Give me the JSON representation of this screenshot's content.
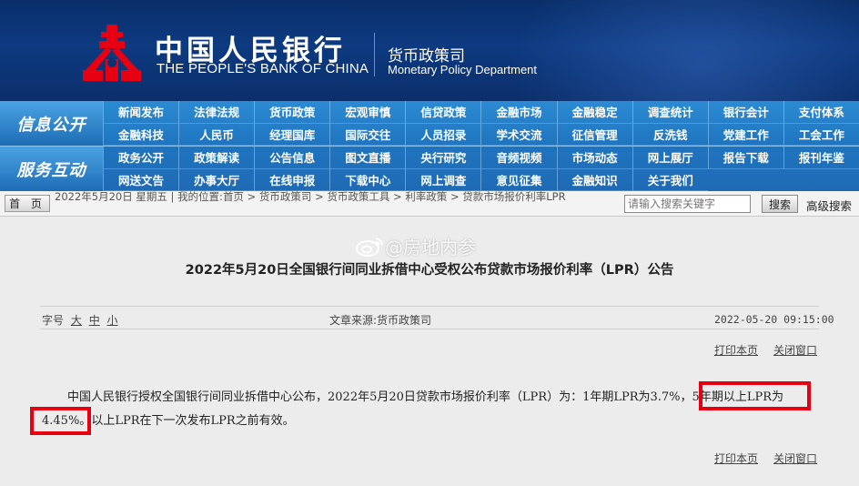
{
  "header": {
    "bank_name_cn": "中国人民银行",
    "bank_name_en": "THE PEOPLE'S BANK OF CHINA",
    "dept_cn": "货币政策司",
    "dept_en": "Monetary Policy Department",
    "bg_color": "#0b3272",
    "logo_color": "#e60012"
  },
  "nav": {
    "section_info": "信息公开",
    "section_service": "服务互动",
    "info_items": [
      "新闻发布",
      "法律法规",
      "货币政策",
      "宏观审慎",
      "信贷政策",
      "金融市场",
      "金融稳定",
      "调查统计",
      "银行会计",
      "支付体系",
      "金融科技",
      "人民币",
      "经理国库",
      "国际交往",
      "人员招录",
      "学术交流",
      "征信管理",
      "反洗钱",
      "党建工作",
      "工会工作"
    ],
    "service_items": [
      "政务公开",
      "政策解读",
      "公告信息",
      "图文直播",
      "央行研究",
      "音频视频",
      "市场动态",
      "网上展厅",
      "报告下载",
      "报刊年鉴",
      "网送文告",
      "办事大厅",
      "在线申报",
      "下载中心",
      "网上调查",
      "意见征集",
      "金融知识",
      "关于我们"
    ],
    "bg_color": "#1f74bf"
  },
  "breadcrumb": {
    "home_label": "首 页",
    "date_text": "2022年5月20日 星期五",
    "location_label": "我的位置:",
    "path": [
      "首页",
      "货币政策司",
      "货币政策工具",
      "利率政策",
      "贷款市场报价利率LPR"
    ]
  },
  "search": {
    "placeholder": "请输入搜索关键字",
    "button_label": "搜索",
    "advanced_label": "高级搜索"
  },
  "watermark": {
    "text": "@房地内参"
  },
  "article": {
    "title": "2022年5月20日全国银行间同业拆借中心受权公布贷款市场报价利率（LPR）公告",
    "font_size_label": "字号",
    "font_sizes": [
      "大",
      "中",
      "小"
    ],
    "source_label": "文章来源:",
    "source": "货币政策司",
    "datetime": "2022-05-20  09:15:00",
    "print_label": "打印本页",
    "close_label": "关闭窗口",
    "body_before": "中国人民银行授权全国银行间同业拆借中心公布，2022年5月20日贷款市场报价利率（LPR）为：1年期LPR为3.7%，",
    "body_highlight": "5年期以上LPR为4.45%。",
    "body_after": "以上LPR在下一次发布LPR之前有效。",
    "highlight_color": "#e60012"
  }
}
